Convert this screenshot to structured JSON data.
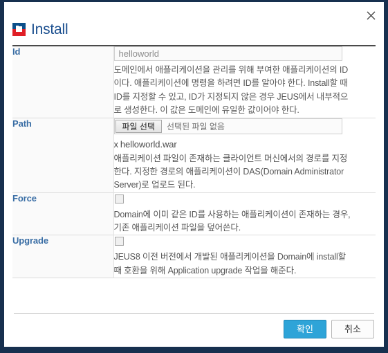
{
  "window": {
    "title": "Install",
    "icon": "jeus-logo-icon",
    "close_icon": "close-icon",
    "frame_color": "#17304f",
    "title_color": "#1b4f8f"
  },
  "form": {
    "rows": [
      {
        "key": "id",
        "label": "Id",
        "control": "text",
        "value": "helloworld",
        "placeholder": "helloworld",
        "description": "도메인에서 애플리케이션을 관리를 위해 부여한 애플리케이션의 ID이다. 애플리케이션에 명령을 하려면 ID를 알아야 한다. Install할 때 ID를 지정할 수 있고, ID가 지정되지 않은 경우 JEUS에서 내부적으로 생성한다. 이 값은 도메인에 유일한 값이어야 한다."
      },
      {
        "key": "path",
        "label": "Path",
        "control": "file",
        "file_button_label": "파일 선택",
        "file_status": "선택된 파일 없음",
        "chosen_file_remove": "x",
        "chosen_file": "helloworld.war",
        "description": "애플리케이션 파일이 존재하는 클라이언트 머신에서의 경로를 지정한다. 지정한 경로의 애플리케이션이 DAS(Domain Administrator Server)로 업로드 된다."
      },
      {
        "key": "force",
        "label": "Force",
        "control": "checkbox",
        "checked": false,
        "description": "Domain에 이미 같은 ID를 사용하는 애플리케이션이 존재하는 경우, 기존 애플리케이션 파일을 덮어쓴다."
      },
      {
        "key": "upgrade",
        "label": "Upgrade",
        "control": "checkbox",
        "checked": false,
        "description": "JEUS8 이전 버전에서 개발된 애플리케이션을 Domain에 install할 때 호환을 위해 Application upgrade 작업을 해준다."
      }
    ]
  },
  "footer": {
    "confirm_label": "확인",
    "cancel_label": "취소",
    "confirm_color": "#2ea4d8"
  }
}
